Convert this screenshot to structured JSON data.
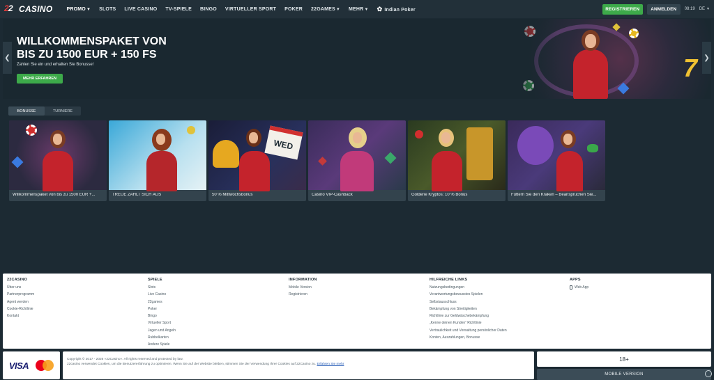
{
  "header": {
    "logo_text": "CASINO",
    "logo_mark_a": "2",
    "logo_mark_b": "2",
    "nav": [
      {
        "label": "PROMO",
        "caret": true
      },
      {
        "label": "SLOTS",
        "caret": false
      },
      {
        "label": "LIVE CASINO",
        "caret": false
      },
      {
        "label": "TV-SPIELE",
        "caret": false
      },
      {
        "label": "BINGO",
        "caret": false
      },
      {
        "label": "VIRTUELLER SPORT",
        "caret": false
      },
      {
        "label": "POKER",
        "caret": false
      },
      {
        "label": "22GAMES",
        "caret": true
      },
      {
        "label": "MEHR",
        "caret": true
      }
    ],
    "indian_poker_label": "Indian Poker",
    "register_label": "REGISTRIEREN",
    "login_label": "ANMELDEN",
    "clock": "08:19",
    "lang": "DE"
  },
  "banner": {
    "title_line1": "WILLKOMMENSPAKET VON",
    "title_line2": "BIS ZU 1500 EUR + 150 FS",
    "subtitle": "Zahlen Sie ein und erhalten Sie Bonusse!",
    "button_label": "MEHR ERFAHREN",
    "seven": "7"
  },
  "tabs": [
    "BONUSSE",
    "TURNIERE"
  ],
  "cards": [
    {
      "label": "Willkommenspaket von bis zu 1500 EUR +..."
    },
    {
      "label": "TREUE ZAHLT SICH AUS"
    },
    {
      "label": "50 % Mittwochsbonus"
    },
    {
      "label": "Casino VIP-Cashback"
    },
    {
      "label": "Goldene Kryptos: 10 % Bonus"
    },
    {
      "label": "Füttern Sie den Kraken – Beanspruchen Sie..."
    }
  ],
  "card_misc": {
    "wed": "WED"
  },
  "footer": {
    "columns": [
      {
        "title": "22CASINO",
        "links": [
          "Über uns",
          "Partnerprogramm",
          "Agent werden",
          "Cookie-Richtlinie",
          "Kontakt"
        ]
      },
      {
        "title": "SPIELE",
        "links": [
          "Slots",
          "Live Casino",
          "22games",
          "Poker",
          "Bingo",
          "Virtueller Sport",
          "Jagen und Angeln",
          "Rubbelkarten",
          "Andere Spiele"
        ]
      },
      {
        "title": "INFORMATION",
        "links": [
          "Mobile Version",
          "Registrieren"
        ]
      },
      {
        "title": "HILFREICHE LINKS",
        "links": [
          "Nutzungsbedingungen",
          "Verantwortungsbewusstes Spielen",
          "Selbstausschluss",
          "Bekämpfung von Streitigkeiten",
          "Richtlinie zur Geldwäschebekämpfung",
          "„Kenne deinen Kunden“ Richtlinie",
          "Vertraulichkeit und Verwaltung persönlicher Daten",
          "Konten, Auszahlungen, Bonusse"
        ]
      },
      {
        "title": "APPS",
        "links": [
          "Web App"
        ]
      }
    ],
    "copyright": "Copyright © 2017 - 2026 «22Casino». All rights reserved and protected by law.",
    "cookie_text": "22casino verwendet Cookies, um die Benutzererfahrung zu optimieren. Wenn Sie auf der Website bleiben, stimmen Sie der Verwendung Ihrer Cookies auf 22Casino zu.",
    "cookie_more": "Erfahren Sie mehr",
    "visa": "VISA",
    "age": "18+",
    "mobile_version": "MOBILE VERSION"
  }
}
